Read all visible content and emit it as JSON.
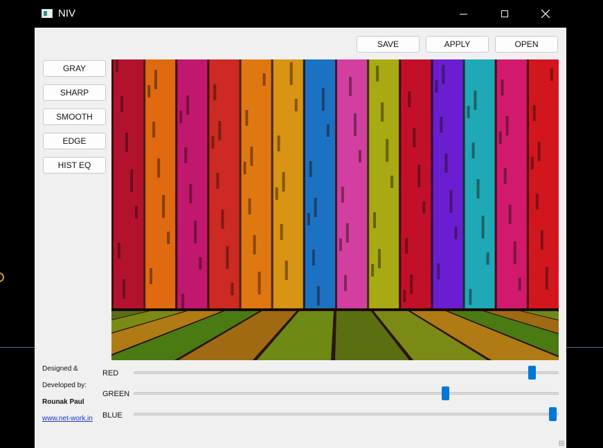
{
  "window": {
    "title": "NIV",
    "icon": "niv-app-icon"
  },
  "titlebar_controls": [
    "minimize-icon",
    "maximize-icon",
    "close-icon"
  ],
  "toolbar": {
    "save_label": "SAVE",
    "apply_label": "APPLY",
    "open_label": "OPEN"
  },
  "filters": [
    {
      "label": "GRAY"
    },
    {
      "label": "SHARP"
    },
    {
      "label": "SMOOTH"
    },
    {
      "label": "EDGE"
    },
    {
      "label": "HIST EQ"
    }
  ],
  "credits": {
    "line1": "Designed &",
    "line2": "Developed by:",
    "author": "Rounak Paul",
    "website": "www.net-work.in"
  },
  "channels": [
    {
      "label": "RED",
      "value": 0.95
    },
    {
      "label": "GREEN",
      "value": 0.743
    },
    {
      "label": "BLUE",
      "value": 1.0
    }
  ],
  "colors": {
    "slider_accent": "#0078d7",
    "link": "#1a35c8",
    "client_bg": "#f0f0f0"
  },
  "image": {
    "description_icon": "colorful-wooden-planks-image",
    "plank_colors": [
      "#b3122e",
      "#e06a10",
      "#c2176e",
      "#cc2a22",
      "#e07812",
      "#d89412",
      "#1c72c2",
      "#d23fa0",
      "#a7aa12",
      "#c3102a",
      "#6a1ed0",
      "#1fa9b6",
      "#d21a6c",
      "#d2161e"
    ],
    "floor_colors": [
      "#5a6e12",
      "#7a8a14",
      "#b07a14",
      "#4a7a12",
      "#a06a12",
      "#6e8a14"
    ]
  }
}
